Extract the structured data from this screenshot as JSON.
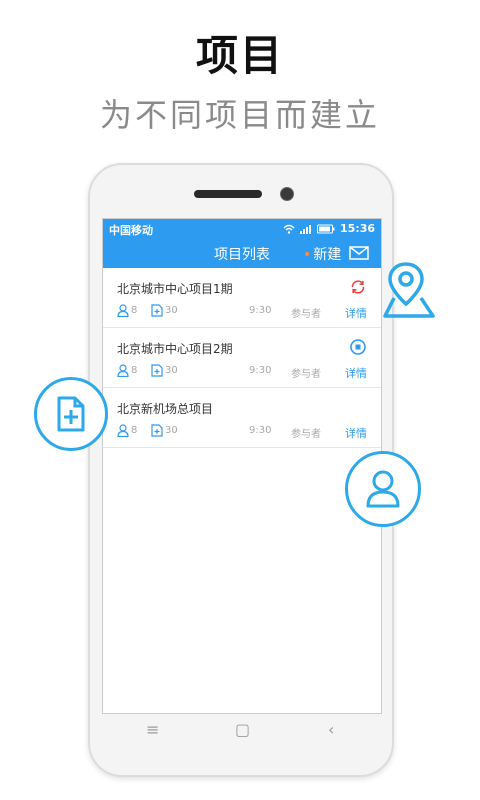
{
  "hero": {
    "title": "项目",
    "subtitle": "为不同项目而建立"
  },
  "statusbar": {
    "carrier": "中国移动",
    "time": "15:36"
  },
  "navbar": {
    "title": "项目列表",
    "new_label": "新建",
    "new_dot": "•"
  },
  "projects": [
    {
      "title": "北京城市中心项目1期",
      "people": "8",
      "docs": "30",
      "time": "9:30",
      "participants_label": "参与者",
      "detail_label": "详情",
      "status_icon": "refresh-icon",
      "status_color": "#f04040"
    },
    {
      "title": "北京城市中心项目2期",
      "people": "8",
      "docs": "30",
      "time": "9:30",
      "participants_label": "参与者",
      "detail_label": "详情",
      "status_icon": "stop-icon",
      "status_color": "#2d9bf0"
    },
    {
      "title": "北京新机场总项目",
      "people": "8",
      "docs": "30",
      "time": "9:30",
      "participants_label": "参与者",
      "detail_label": "详情",
      "status_icon": "",
      "status_color": ""
    }
  ],
  "softkeys": {
    "menu": "≡",
    "home": "▢",
    "back": "‹"
  },
  "colors": {
    "accent": "#2d9bf0",
    "float_accent": "#2da9e9"
  }
}
